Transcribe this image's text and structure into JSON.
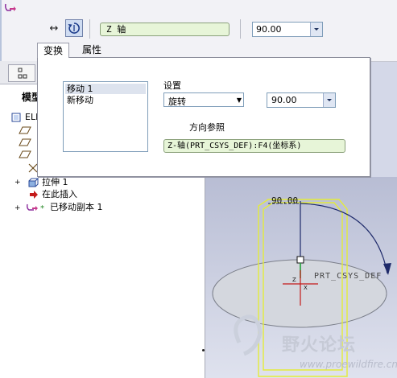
{
  "dashboard": {
    "reference_field": "Z 轴",
    "value": "90.00",
    "tabs": [
      {
        "label": "变换"
      },
      {
        "label": "属性"
      }
    ]
  },
  "transform_panel": {
    "moves": [
      {
        "label": "移动 1"
      },
      {
        "label": "新移动"
      }
    ],
    "settings_label": "设置",
    "type_value": "旋转",
    "angle_value": "90.00",
    "direction_ref_label": "方向参照",
    "direction_ref_value": "Z-轴(PRT_CSYS_DEF):F4(坐标系)"
  },
  "model_tree": {
    "title": "模型",
    "items": [
      {
        "label": "ELI"
      },
      {
        "label": "拉伸 1"
      },
      {
        "label": "在此插入"
      },
      {
        "label": "已移动副本 1"
      }
    ]
  },
  "viewport": {
    "dimension": "90.00",
    "csys_label": "PRT_CSYS_DEF",
    "axis_z": "Z",
    "axis_x": "X"
  },
  "watermark": {
    "text": "野火论坛",
    "url": "www.proewildfire.cn"
  },
  "colors": {
    "selected_green_field": "#e7f5d8",
    "panel_border": "#8c8e9c",
    "viewport_bg": "#c9cde0",
    "highlight_yellow": "#e8f03c"
  }
}
